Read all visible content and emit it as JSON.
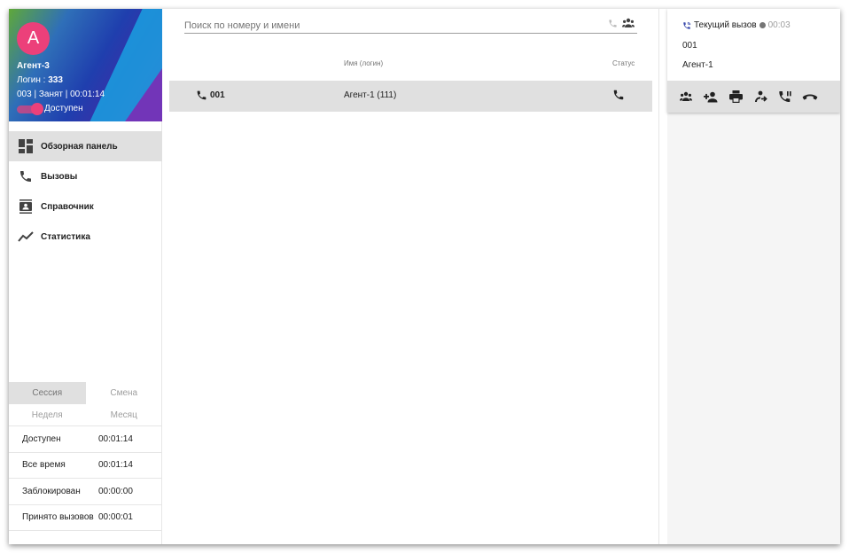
{
  "profile": {
    "avatar_letter": "А",
    "name": "Агент-3",
    "login_label": "Логин : ",
    "login_value": "333",
    "state_line": "003 | Занят | 00:01:14",
    "availability": "Доступен",
    "avatar_color": "#ec407a"
  },
  "nav": {
    "items": [
      {
        "label": "Обзорная панель",
        "icon": "dashboard-icon",
        "active": true
      },
      {
        "label": "Вызовы",
        "icon": "phone-icon"
      },
      {
        "label": "Справочник",
        "icon": "contacts-icon"
      },
      {
        "label": "Статистика",
        "icon": "chart-line-icon"
      }
    ]
  },
  "stats": {
    "tabs": [
      "Сессия",
      "Смена"
    ],
    "subtabs": [
      "Неделя",
      "Месяц"
    ],
    "rows": [
      {
        "label": "Доступен",
        "value": "00:01:14"
      },
      {
        "label": "Все время",
        "value": "00:01:14"
      },
      {
        "label": "Заблокирован",
        "value": "00:00:00"
      },
      {
        "label": "Принято вызовов",
        "value": "00:00:01"
      }
    ]
  },
  "main": {
    "search_placeholder": "Поиск по номеру и имени",
    "columns": {
      "name": "Имя (логин)",
      "status": "Статус"
    },
    "rows": [
      {
        "number": "001",
        "name": "Агент-1 (111)",
        "status_icon": "phone-icon"
      }
    ]
  },
  "current_call": {
    "title": "Текущий вызов",
    "time": "00:03",
    "number": "001",
    "name": "Агент-1",
    "actions": [
      "group-icon",
      "add-person-icon",
      "print-icon",
      "transfer-icon",
      "phone-pause-icon",
      "hangup-icon"
    ]
  }
}
